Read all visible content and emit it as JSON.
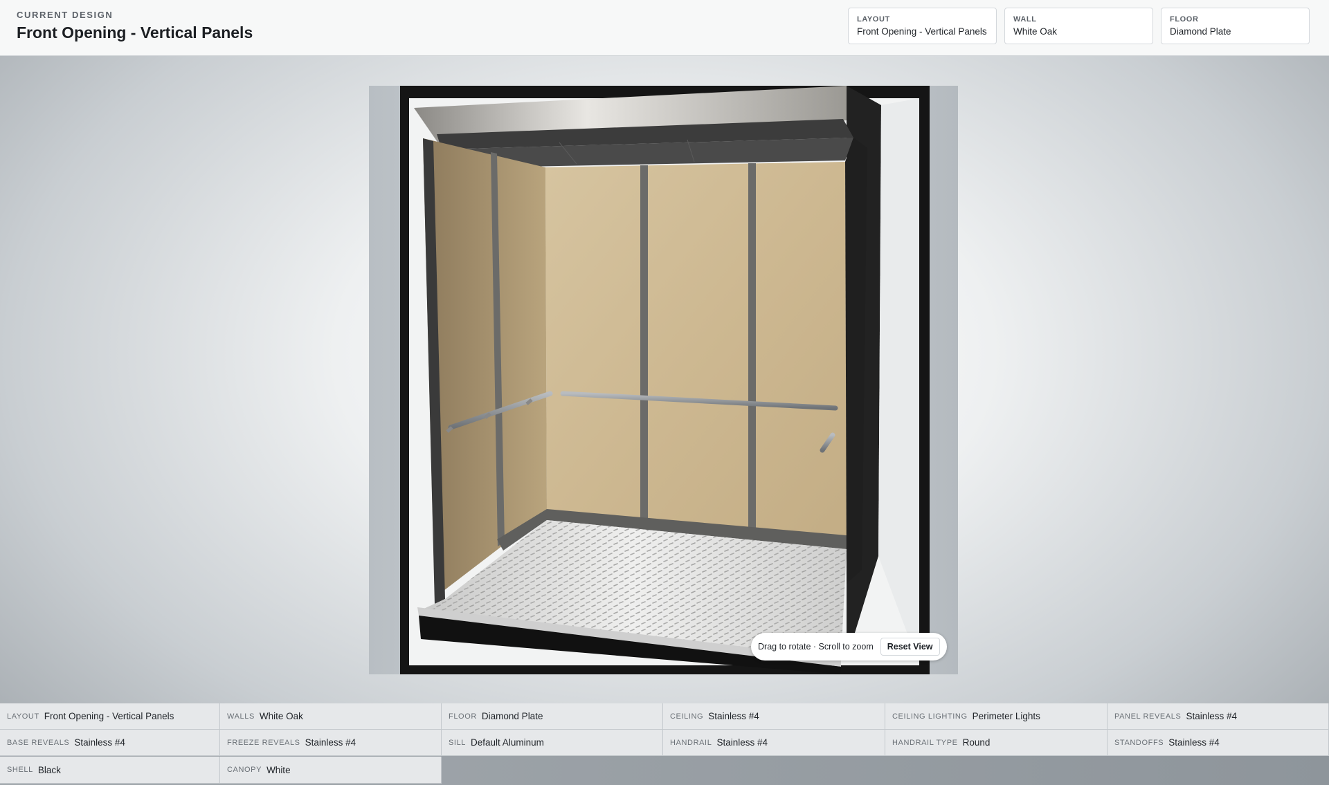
{
  "header": {
    "eyebrow": "CURRENT DESIGN",
    "title": "Front Opening - Vertical Panels",
    "chips": [
      {
        "label": "LAYOUT",
        "value": "Front Opening - Vertical Panels"
      },
      {
        "label": "WALL",
        "value": "White Oak"
      },
      {
        "label": "FLOOR",
        "value": "Diamond Plate"
      }
    ]
  },
  "viewer": {
    "hint": "Drag to rotate · Scroll to zoom",
    "reset_label": "Reset View"
  },
  "specs": [
    {
      "label": "LAYOUT",
      "value": "Front Opening - Vertical Panels"
    },
    {
      "label": "WALLS",
      "value": "White Oak"
    },
    {
      "label": "FLOOR",
      "value": "Diamond Plate"
    },
    {
      "label": "CEILING",
      "value": "Stainless #4"
    },
    {
      "label": "CEILING LIGHTING",
      "value": "Perimeter Lights"
    },
    {
      "label": "PANEL REVEALS",
      "value": "Stainless #4"
    },
    {
      "label": "BASE REVEALS",
      "value": "Stainless #4"
    },
    {
      "label": "FREEZE REVEALS",
      "value": "Stainless #4"
    },
    {
      "label": "SILL",
      "value": "Default Aluminum"
    },
    {
      "label": "HANDRAIL",
      "value": "Stainless #4"
    },
    {
      "label": "HANDRAIL TYPE",
      "value": "Round"
    },
    {
      "label": "STANDOFFS",
      "value": "Stainless #4"
    },
    {
      "label": "SHELL",
      "value": "Black"
    },
    {
      "label": "CANOPY",
      "value": "White"
    }
  ]
}
